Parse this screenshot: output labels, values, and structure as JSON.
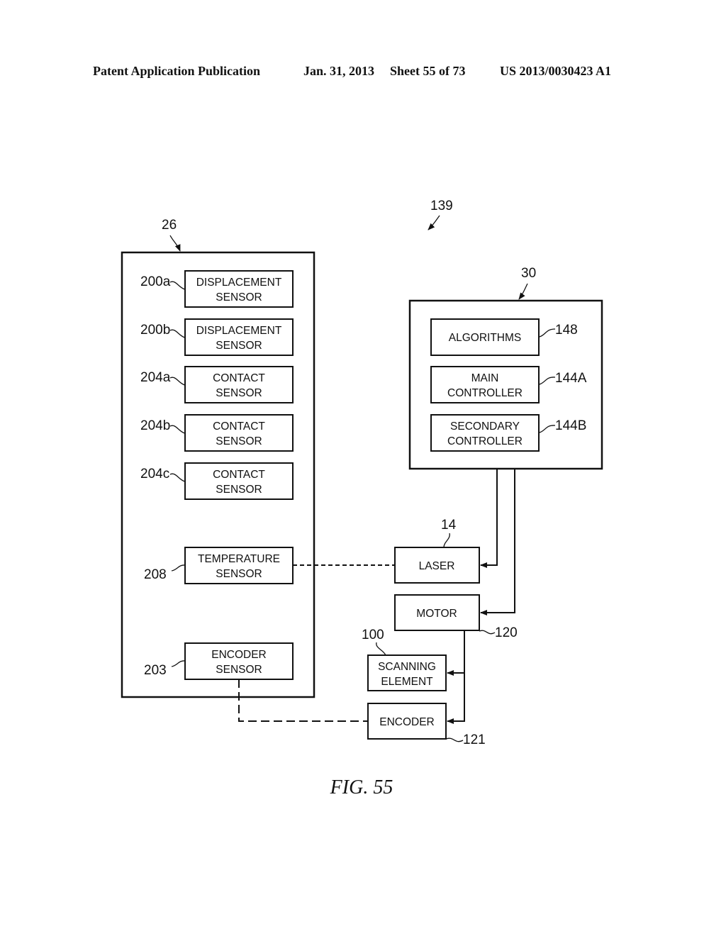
{
  "header": {
    "publication": "Patent Application Publication",
    "date": "Jan. 31, 2013",
    "sheet": "Sheet 55 of 73",
    "number": "US 2013/0030423 A1"
  },
  "figure": {
    "caption": "FIG. 55",
    "system_ref": "139"
  },
  "left_module": {
    "ref": "26",
    "components": [
      {
        "ref": "200a",
        "line1": "DISPLACEMENT",
        "line2": "SENSOR"
      },
      {
        "ref": "200b",
        "line1": "DISPLACEMENT",
        "line2": "SENSOR"
      },
      {
        "ref": "204a",
        "line1": "CONTACT",
        "line2": "SENSOR"
      },
      {
        "ref": "204b",
        "line1": "CONTACT",
        "line2": "SENSOR"
      },
      {
        "ref": "204c",
        "line1": "CONTACT",
        "line2": "SENSOR"
      },
      {
        "ref": "208",
        "line1": "TEMPERATURE",
        "line2": "SENSOR"
      },
      {
        "ref": "203",
        "line1": "ENCODER",
        "line2": "SENSOR"
      }
    ]
  },
  "right_module": {
    "ref": "30",
    "components": [
      {
        "ref": "148",
        "line1": "ALGORITHMS",
        "line2": ""
      },
      {
        "ref": "144A",
        "line1": "MAIN",
        "line2": "CONTROLLER"
      },
      {
        "ref": "144B",
        "line1": "SECONDARY",
        "line2": "CONTROLLER"
      }
    ]
  },
  "devices": [
    {
      "ref": "14",
      "line1": "LASER"
    },
    {
      "ref": "120",
      "line1": "MOTOR"
    },
    {
      "ref": "100",
      "line1": "SCANNING",
      "line2": "ELEMENT"
    },
    {
      "ref": "121",
      "line1": "ENCODER"
    }
  ]
}
